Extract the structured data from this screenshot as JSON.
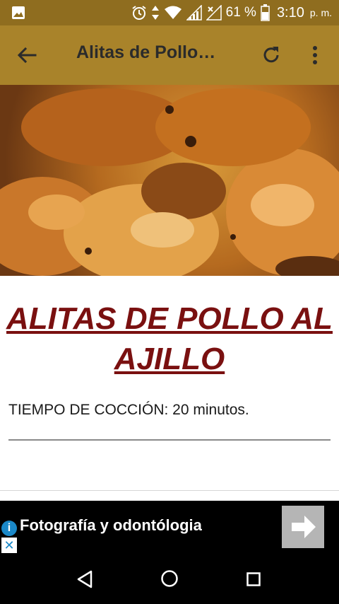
{
  "status_bar": {
    "battery": "61 %",
    "time": "3:10",
    "ampm": "p. m."
  },
  "app_bar": {
    "title": "Alitas de Pollo…"
  },
  "recipe": {
    "title_line1": "ALITAS DE POLLO AL",
    "title_line2": "AJILLO",
    "cook_time": "TIEMPO DE COCCIÓN: 20 minutos."
  },
  "ad": {
    "text": "Fotografía y odontólogia"
  },
  "colors": {
    "status_bar": "#8f6d1f",
    "app_bar": "#a9832a",
    "title_red": "#7a1010"
  },
  "icons": [
    "image-icon",
    "alarm-icon",
    "data-arrows-icon",
    "wifi-icon",
    "signal-icon",
    "signal-x-icon",
    "battery-icon",
    "back-arrow-icon",
    "refresh-icon",
    "more-vert-icon",
    "info-icon",
    "close-icon",
    "arrow-right-icon",
    "nav-back-icon",
    "nav-home-icon",
    "nav-recent-icon"
  ]
}
